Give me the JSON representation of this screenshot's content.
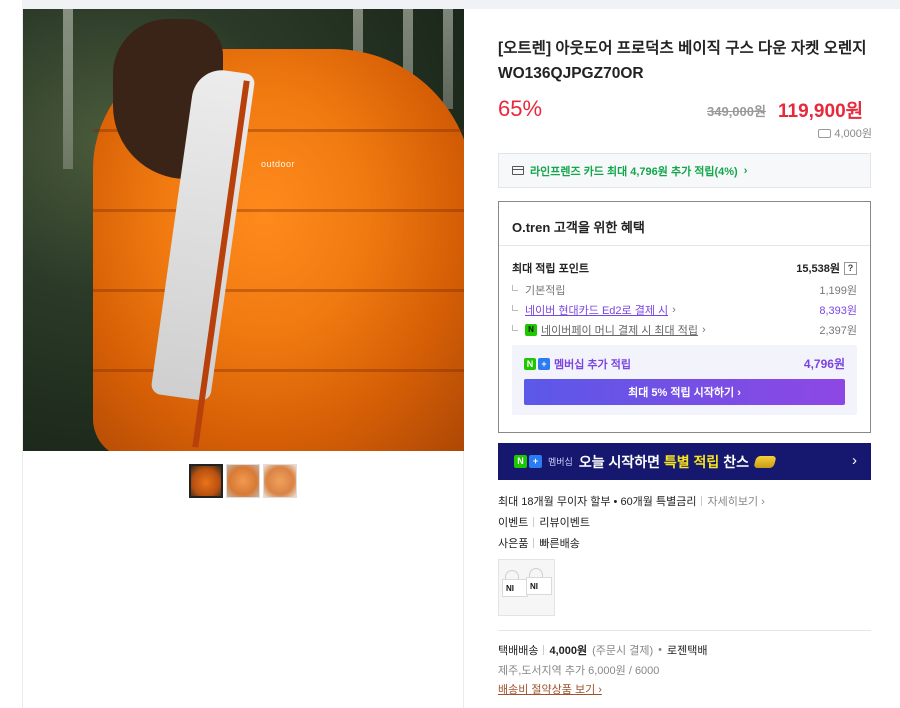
{
  "product": {
    "title": "[오트렌] 아웃도어 프로덕츠 베이직 구스 다운 자켓 오렌지 WO136QJPGZ70OR",
    "discount_rate": "65%",
    "original_price": "349,000원",
    "sale_price": "119,900원",
    "shipping_fee": "4,000원",
    "image_logo_text": "outdoor"
  },
  "thumbnails": [
    {
      "name": "thumbnail-1",
      "selected": true
    },
    {
      "name": "thumbnail-2",
      "selected": false
    },
    {
      "name": "thumbnail-3",
      "selected": false
    }
  ],
  "card_promo": {
    "text": "라인프렌즈 카드 최대 4,796원 추가 적립(4%)",
    "chevron": "›"
  },
  "benefits": {
    "title": "O.tren 고객을 위한 혜택",
    "max_points_label": "최대 적립 포인트",
    "max_points_value": "15,538원",
    "help": "?",
    "rows": [
      {
        "label": "기본적립",
        "value": "1,199원"
      },
      {
        "label": "네이버 현대카드 Ed2로 결제 시",
        "suffix": "›",
        "value": "8,393원"
      },
      {
        "label": "네이버페이 머니 결제 시 최대 적립",
        "suffix": "›",
        "value": "2,397원",
        "badge": "N"
      }
    ],
    "membership": {
      "logo_n": "N",
      "logo_plus": "+",
      "label": "멤버십 추가 적립",
      "value": "4,796원",
      "button": "최대 5% 적립 시작하기 ›"
    }
  },
  "banner": {
    "logo_n": "N",
    "logo_plus": "+",
    "membership": "멤버십",
    "text_pre": "오늘 시작하면",
    "text_highlight": "특별 적립",
    "text_post": "찬스",
    "chevron": "›"
  },
  "installment": {
    "text": "최대 18개월 무이자 할부 • 60개월 특별금리",
    "link": "자세히보기 ›"
  },
  "event": {
    "label": "이벤트",
    "value": "리뷰이벤트"
  },
  "gift": {
    "label": "사은품",
    "value": "빠른배송",
    "image_text_1": "NI",
    "image_text_2": "NI"
  },
  "shipping": {
    "method": "택배배송",
    "fee": "4,000원",
    "fee_note": "(주문시 결제)",
    "dot": "•",
    "carrier": "로젠택배",
    "extra": "제주,도서지역 추가 6,000원 / 6000",
    "link": "배송비 절약상품 보기 ›"
  },
  "colors": {
    "sale_red": "#e8283b",
    "naver_green": "#1ec800",
    "membership_purple": "#7a45e0",
    "banner_navy": "#15186e",
    "banner_yellow": "#f7e61d"
  },
  "icons": [
    "truck-icon",
    "card-icon",
    "chevron-right-icon",
    "help-icon",
    "naver-pay-icon",
    "naver-plus-icon",
    "coin-icon"
  ]
}
